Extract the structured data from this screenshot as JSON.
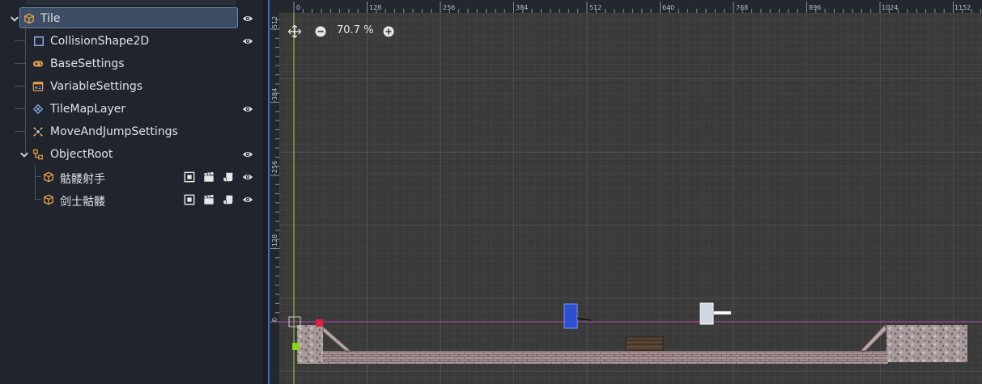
{
  "scene_tree": {
    "nodes": [
      {
        "label": "Tile",
        "icon": "node3d-cube-icon",
        "selected": true,
        "visible": true
      },
      {
        "label": "CollisionShape2D",
        "icon": "collision-shape-icon",
        "visible": true
      },
      {
        "label": "BaseSettings",
        "icon": "gamepad-icon"
      },
      {
        "label": "VariableSettings",
        "icon": "variable-script-icon"
      },
      {
        "label": "TileMapLayer",
        "icon": "tilemap-icon",
        "visible": true
      },
      {
        "label": "MoveAndJumpSettings",
        "icon": "move-jump-icon"
      },
      {
        "label": "ObjectRoot",
        "icon": "object-root-icon",
        "expanded": true,
        "visible": true
      },
      {
        "label": "骷髅射手",
        "icon": "node3d-cube-icon",
        "visible": true
      },
      {
        "label": "剑士骷髅",
        "icon": "node3d-cube-icon",
        "visible": true
      }
    ]
  },
  "viewport": {
    "zoom_label": "70.7 %",
    "ruler_top_labels": [
      "0",
      "128",
      "256",
      "384",
      "512",
      "640",
      "768",
      "896",
      "1024",
      "1152"
    ],
    "ruler_left_labels": [
      "-512",
      "-384",
      "-256",
      "-128",
      "0"
    ]
  },
  "colors": {
    "panel_bg": "#20252d",
    "selection": "#3d4d63",
    "accent": "#4a6bb0",
    "icon_orange": "#e8a04a",
    "icon_blue": "#8fb3e8",
    "viewport_bg": "#3a3a3a"
  }
}
